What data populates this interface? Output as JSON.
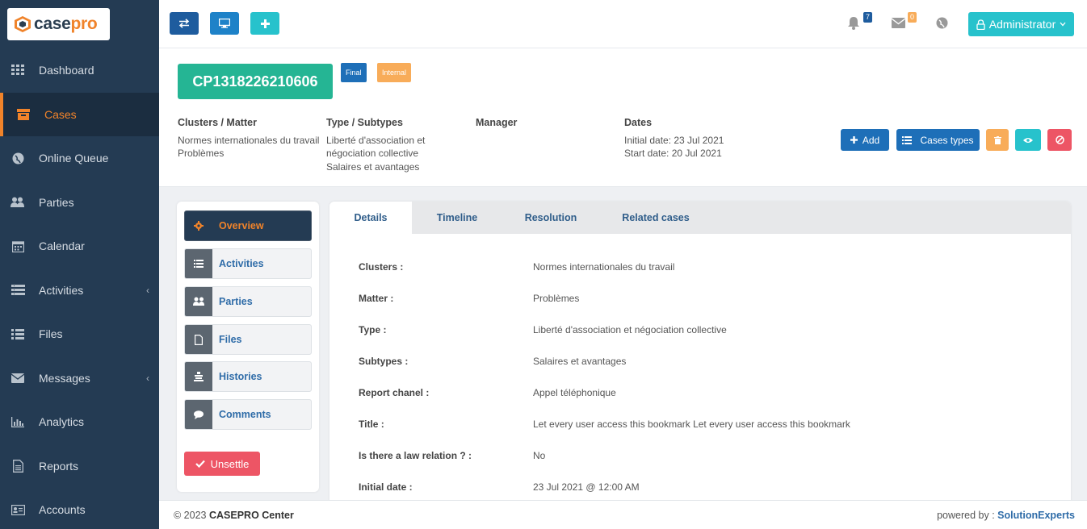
{
  "logo": {
    "case": "case",
    "pro": "pro"
  },
  "nav": [
    {
      "label": "Dashboard",
      "icon": "grid-icon"
    },
    {
      "label": "Cases",
      "icon": "archive-icon"
    },
    {
      "label": "Online Queue",
      "icon": "globe-icon"
    },
    {
      "label": "Parties",
      "icon": "users-icon"
    },
    {
      "label": "Calendar",
      "icon": "calendar-icon"
    },
    {
      "label": "Activities",
      "icon": "list-alt-icon"
    },
    {
      "label": "Files",
      "icon": "list-icon"
    },
    {
      "label": "Messages",
      "icon": "envelope-icon"
    },
    {
      "label": "Analytics",
      "icon": "bar-chart-icon"
    },
    {
      "label": "Reports",
      "icon": "file-text-icon"
    },
    {
      "label": "Accounts",
      "icon": "id-card-icon"
    }
  ],
  "topbar": {
    "notifications_count": "7",
    "messages_count": "0",
    "admin_label": "Administrator"
  },
  "case": {
    "id": "CP1318226210606",
    "tag_final": "Final",
    "tag_internal": "Internal",
    "clusters_header": "Clusters / Matter",
    "clusters_line1": "Normes internationales du travail",
    "clusters_line2": "Problèmes",
    "type_header": "Type / Subtypes",
    "type_line1": "Liberté d'association et",
    "type_line2": "négociation collective",
    "type_line3": "Salaires et avantages",
    "manager_header": "Manager",
    "dates_header": "Dates",
    "dates_line1": "Initial date: 23 Jul 2021",
    "dates_line2": "Start date: 20 Jul 2021",
    "add_label": "Add",
    "cases_types_label": "Cases types"
  },
  "left_menu": {
    "overview": "Overview",
    "activities": "Activities",
    "parties": "Parties",
    "files": "Files",
    "histories": "Histories",
    "comments": "Comments",
    "unsettle": "Unsettle"
  },
  "tabs": {
    "details": "Details",
    "timeline": "Timeline",
    "resolution": "Resolution",
    "related": "Related cases"
  },
  "details": [
    {
      "label": "Clusters :",
      "value": "Normes internationales du travail"
    },
    {
      "label": "Matter :",
      "value": "Problèmes"
    },
    {
      "label": "Type :",
      "value": "Liberté d'association et négociation collective"
    },
    {
      "label": "Subtypes :",
      "value": "Salaires et avantages"
    },
    {
      "label": "Report chanel :",
      "value": "Appel téléphonique"
    },
    {
      "label": "Title :",
      "value": "Let every user access this bookmark Let every user access this bookmark"
    },
    {
      "label": "Is there a law relation ? :",
      "value": "No"
    },
    {
      "label": "Initial date :",
      "value": "23 Jul 2021 @ 12:00 AM"
    }
  ],
  "footer": {
    "copyright": "© 2023",
    "company": "CASEPRO Center",
    "powered": "powered by :",
    "brand": "SolutionExperts"
  },
  "colors": {
    "sidebar": "#243b53",
    "accent": "#f0832a",
    "case_id": "#25b594",
    "primary": "#1e6fb8",
    "teal": "#27c2cc",
    "danger": "#ed5565",
    "warning": "#f8ac59"
  }
}
